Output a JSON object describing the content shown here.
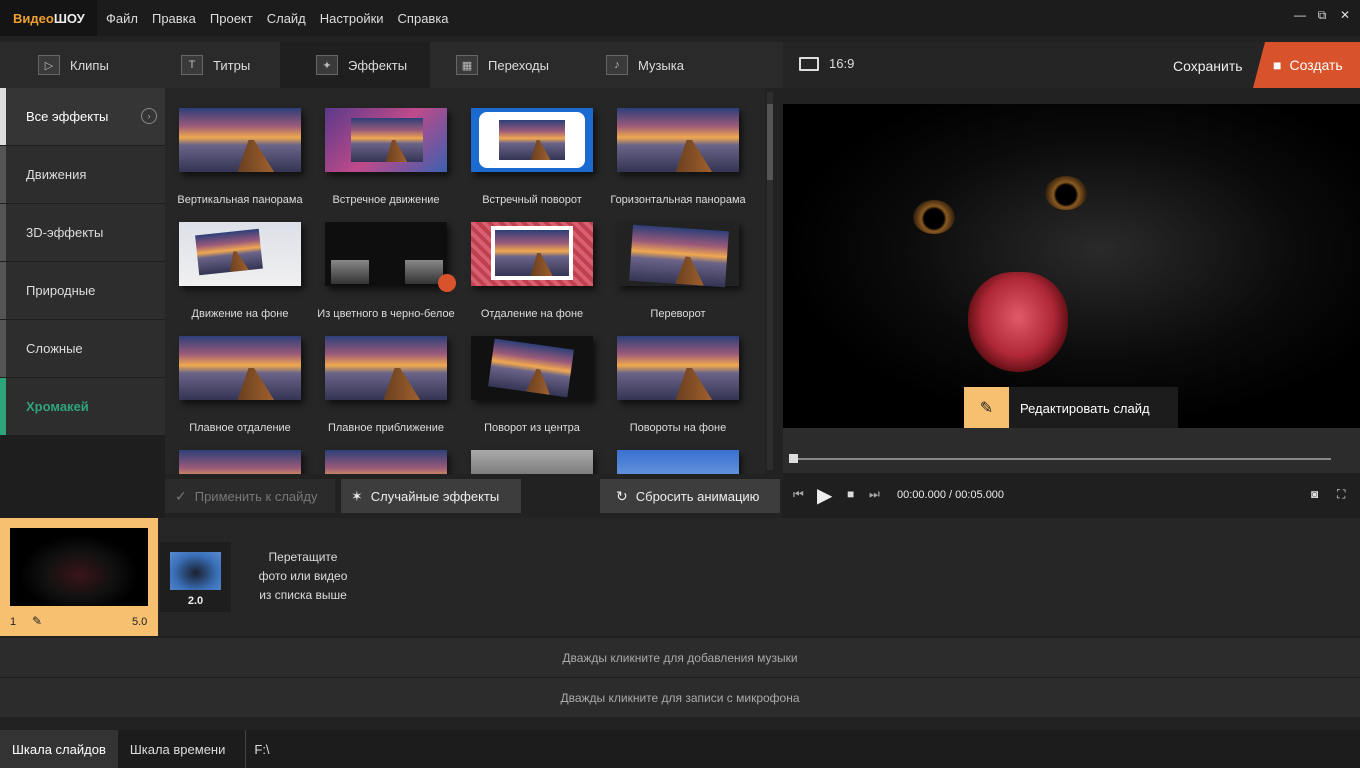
{
  "app": {
    "logo_part1": "Видео",
    "logo_part2": "ШОУ"
  },
  "menu": [
    "Файл",
    "Правка",
    "Проект",
    "Слайд",
    "Настройки",
    "Справка"
  ],
  "window_controls": {
    "minimize": "—",
    "restore": "⧉",
    "close": "✕"
  },
  "tabs": [
    {
      "label": "Клипы",
      "icon": "play-icon"
    },
    {
      "label": "Титры",
      "icon": "text-icon"
    },
    {
      "label": "Эффекты",
      "icon": "magic-wand-icon",
      "active": true
    },
    {
      "label": "Переходы",
      "icon": "clapper-icon"
    },
    {
      "label": "Музыка",
      "icon": "music-note-icon"
    }
  ],
  "categories": [
    {
      "label": "Все эффекты",
      "active": true
    },
    {
      "label": "Движения"
    },
    {
      "label": "3D-эффекты"
    },
    {
      "label": "Природные"
    },
    {
      "label": "Сложные"
    },
    {
      "label": "Хромакей",
      "accent": "#2fa47a"
    }
  ],
  "effects": [
    "Вертикальная панорама",
    "Встречное движение",
    "Встречный поворот",
    "Горизонтальная панорама",
    "Движение на фоне",
    "Из цветного в черно-белое",
    "Отдаление на фоне",
    "Переворот",
    "Плавное отдаление",
    "Плавное приближение",
    "Поворот из центра",
    "Повороты на фоне"
  ],
  "grid_buttons": {
    "apply": "Применить к слайду",
    "random": "Случайные эффекты",
    "reset": "Сбросить анимацию"
  },
  "preview": {
    "aspect": "16:9",
    "save": "Сохранить",
    "create": "Создать",
    "edit_slide": "Редактировать слайд",
    "time_current": "00:00.000",
    "time_total": "00:05.000"
  },
  "timeline": {
    "slide_number": "1",
    "slide_duration": "5.0",
    "transition_duration": "2.0",
    "drop_hint": [
      "Перетащите",
      "фото или видео",
      "из списка выше"
    ],
    "music_hint": "Дважды кликните для добавления музыки",
    "mic_hint": "Дважды кликните для записи с микрофона"
  },
  "statusbar": {
    "slides_tab": "Шкала слайдов",
    "time_tab": "Шкала времени",
    "path": "F:\\"
  },
  "colors": {
    "accent_orange": "#d8522c",
    "highlight": "#f6c070",
    "green": "#2fa47a"
  }
}
